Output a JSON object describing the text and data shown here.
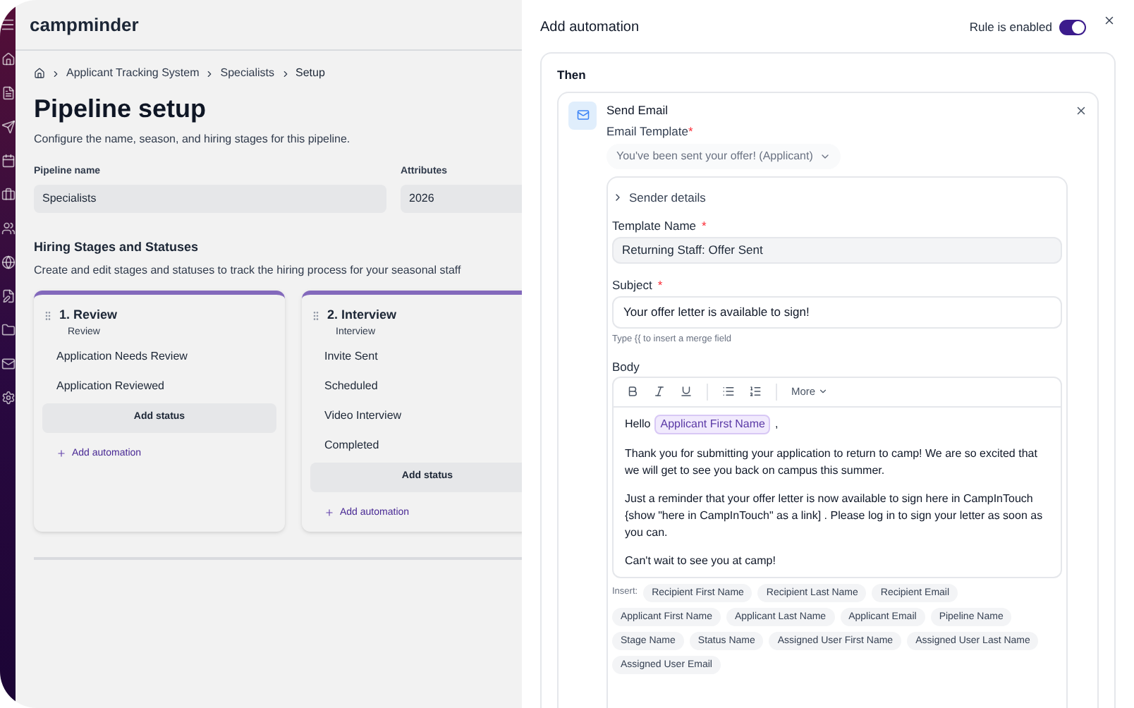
{
  "background_app": {
    "logo": "campminder",
    "breadcrumb": [
      "Applicant Tracking System",
      "Specialists",
      "Setup"
    ],
    "title": "Pipeline setup",
    "subtitle": "Configure the name, season, and hiring stages for this pipeline.",
    "pipeline_name": {
      "label": "Pipeline name",
      "value": "Specialists"
    },
    "attributes": {
      "label": "Attributes",
      "value": "2026"
    },
    "section_title": "Hiring Stages and Statuses",
    "section_description": "Create and edit stages and statuses to track the hiring process for your seasonal staff",
    "stages": [
      {
        "title": "1. Review",
        "subtitle": "Review",
        "statuses": [
          "Application Needs Review",
          "Application Reviewed"
        ],
        "add_status": "Add status",
        "add_automation": "Add automation"
      },
      {
        "title": "2. Interview",
        "subtitle": "Interview",
        "statuses": [
          "Invite Sent",
          "Scheduled",
          "Video Interview",
          "Completed"
        ],
        "add_status": "Add status",
        "add_automation": "Add automation"
      }
    ]
  },
  "drawer": {
    "title": "Add automation",
    "rule_toggle": {
      "label": "Rule is enabled",
      "on": true
    },
    "section_title": "Then",
    "action": {
      "title": "Send Email",
      "template_label": "Email Template",
      "required_mark": "*",
      "template_value": "You've been sent your offer! (Applicant)",
      "sender_details": {
        "label": "Sender details",
        "expanded": false
      },
      "template_name": {
        "label": "Template Name",
        "required_mark": "*",
        "value": "Returning Staff: Offer Sent"
      },
      "subject": {
        "label": "Subject",
        "required_mark": "*",
        "value": "Your offer letter is available to sign!",
        "hint": "Type {{ to insert a merge field"
      },
      "body": {
        "label": "Body",
        "more": "More",
        "paragraphs": [
          [
            {
              "kind": "text",
              "text": "Hello"
            },
            {
              "kind": "chip",
              "text": "Applicant First Name"
            },
            {
              "kind": "text",
              "text": ","
            }
          ],
          [
            {
              "kind": "text",
              "text": "Thank you for submitting your application to return to camp! We are so excited that we will get to see you back on campus this summer."
            }
          ],
          [
            {
              "kind": "text",
              "text": "Just a reminder that your offer letter is now available to sign here in CampInTouch {show \"here in CampInTouch\" as a link] . Please log in to sign your letter as soon as you can."
            }
          ],
          [
            {
              "kind": "text",
              "text": "Can't wait to see you at camp!"
            }
          ]
        ]
      },
      "insert": {
        "label": "Insert:",
        "chips": [
          "Recipient First Name",
          "Recipient Last Name",
          "Recipient Email",
          "Applicant First Name",
          "Applicant Last Name",
          "Applicant Email",
          "Pipeline Name",
          "Stage Name",
          "Status Name",
          "Assigned User First Name",
          "Assigned User Last Name",
          "Assigned User Email"
        ]
      }
    }
  }
}
